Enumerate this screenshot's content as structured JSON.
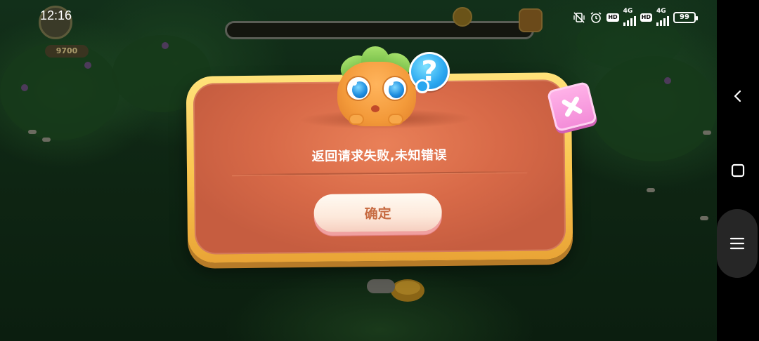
{
  "status_bar": {
    "time": "12:16",
    "network_1": "4G",
    "network_2": "4G",
    "hd_1": "HD",
    "hd_2": "HD",
    "battery": "99"
  },
  "game": {
    "coins": "9700"
  },
  "dialog": {
    "message": "返回请求失败,未知错误",
    "confirm_label": "确定",
    "help_glyph": "?",
    "colors": {
      "frame": "#f9c44d",
      "panel": "#d86a48",
      "button_text": "#c76b42",
      "close": "#f38bd8"
    }
  },
  "nav": {
    "back_icon": "chevron-left-icon",
    "home_icon": "square-icon",
    "menu_icon": "hamburger-menu-icon"
  }
}
